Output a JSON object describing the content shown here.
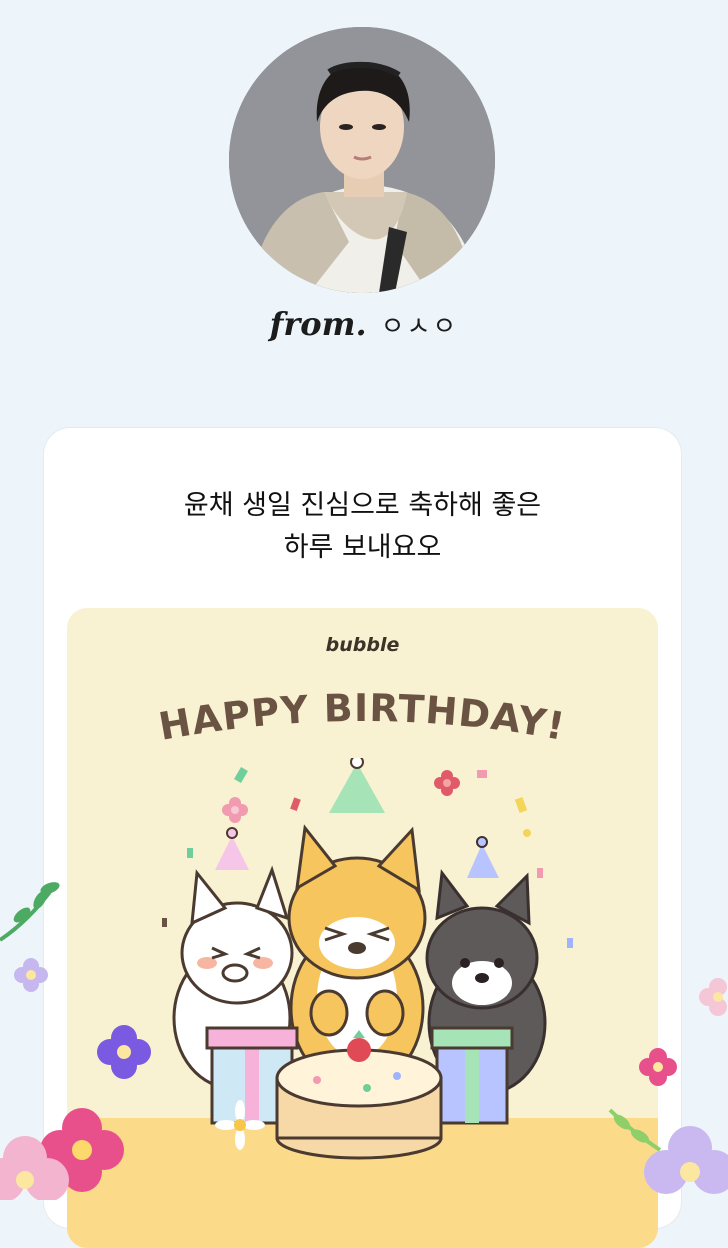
{
  "sender": {
    "from_label": "from.",
    "name": "ㅇㅅㅇ"
  },
  "message": {
    "line1": "윤채 생일 진심으로 축하해 좋은",
    "line2": "하루 보내요오"
  },
  "birthday_card": {
    "brand": "bubble",
    "headline": "HAPPY BIRTHDAY!"
  },
  "colors": {
    "page_background": "#eef5fa",
    "card_background": "#ffffff",
    "birthday_card_background": "#f8f2d2",
    "headline_color": "#6b5344"
  }
}
